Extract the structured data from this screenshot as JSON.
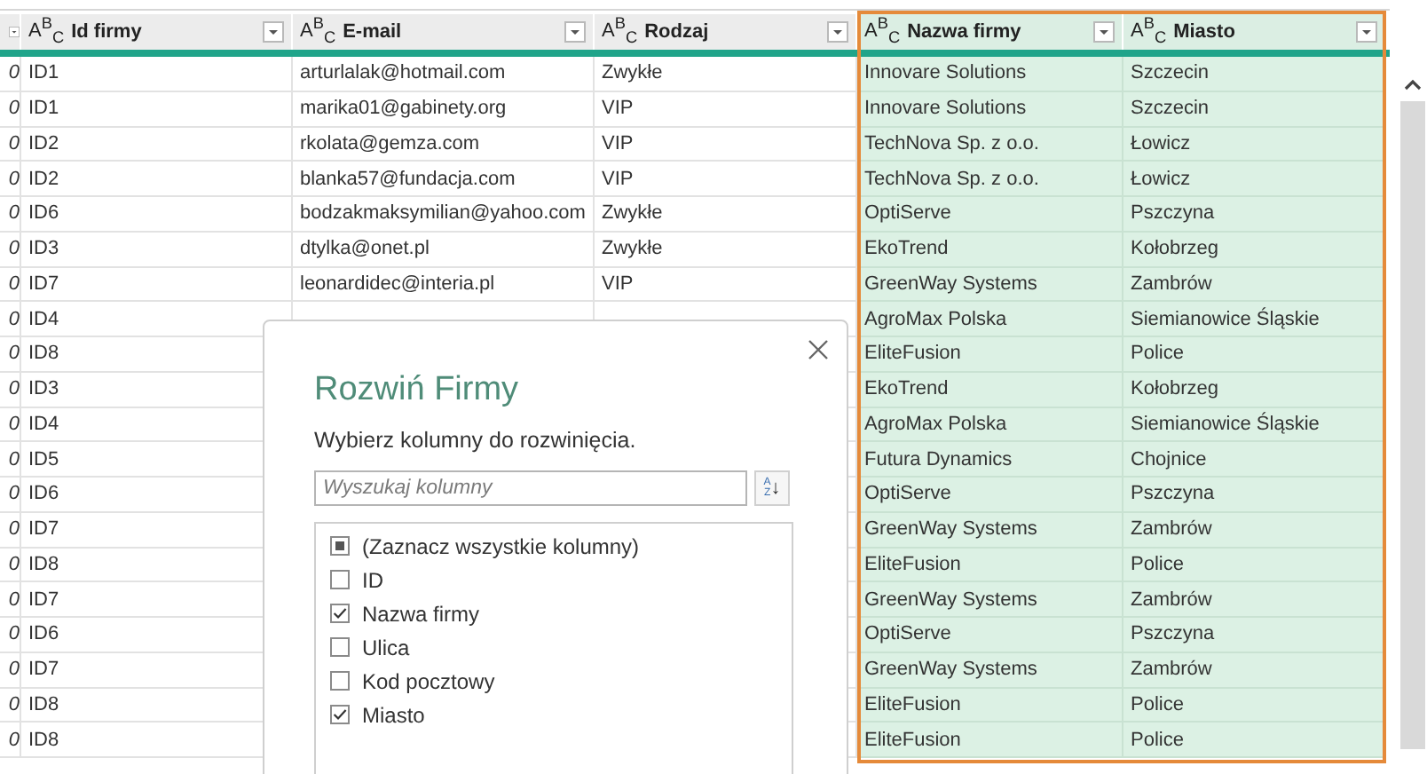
{
  "table": {
    "columns": [
      {
        "selected": false
      },
      {
        "name": "Id firmy",
        "type_icon": "A$^{B}$$_{C}$",
        "selected": false
      },
      {
        "name": "E-mail",
        "type_icon": "A$^{B}$$_{C}$",
        "selected": false
      },
      {
        "name": "Rodzaj",
        "type_icon": "A$^{B}$$_{C}$",
        "selected": false
      },
      {
        "name": "Nazwa firmy",
        "type_icon": "A$^{B}$$_{C}$",
        "selected": true
      },
      {
        "name": "Miasto",
        "type_icon": "A$^{B}$$_{C}$",
        "selected": true
      }
    ],
    "rows": [
      [
        "0",
        "ID1",
        "arturlalak@hotmail.com",
        "Zwykłe",
        "Innovare Solutions",
        "Szczecin"
      ],
      [
        "0",
        "ID1",
        "marika01@gabinety.org",
        "VIP",
        "Innovare Solutions",
        "Szczecin"
      ],
      [
        "0",
        "ID2",
        "rkolata@gemza.com",
        "VIP",
        "TechNova Sp. z o.o.",
        "Łowicz"
      ],
      [
        "0",
        "ID2",
        "blanka57@fundacja.com",
        "VIP",
        "TechNova Sp. z o.o.",
        "Łowicz"
      ],
      [
        "0",
        "ID6",
        "bodzakmaksymilian@yahoo.com",
        "Zwykłe",
        "OptiServe",
        "Pszczyna"
      ],
      [
        "0",
        "ID3",
        "dtylka@onet.pl",
        "Zwykłe",
        "EkoTrend",
        "Kołobrzeg"
      ],
      [
        "0",
        "ID7",
        "leonardidec@interia.pl",
        "VIP",
        "GreenWay Systems",
        "Zambrów"
      ],
      [
        "0",
        "ID4",
        null,
        null,
        "AgroMax Polska",
        "Siemianowice Śląskie"
      ],
      [
        "0",
        "ID8",
        null,
        null,
        "EliteFusion",
        "Police"
      ],
      [
        "0",
        "ID3",
        null,
        null,
        "EkoTrend",
        "Kołobrzeg"
      ],
      [
        "0",
        "ID4",
        null,
        null,
        "AgroMax Polska",
        "Siemianowice Śląskie"
      ],
      [
        "0",
        "ID5",
        null,
        null,
        "Futura Dynamics",
        "Chojnice"
      ],
      [
        "0",
        "ID6",
        null,
        null,
        "OptiServe",
        "Pszczyna"
      ],
      [
        "0",
        "ID7",
        null,
        null,
        "GreenWay Systems",
        "Zambrów"
      ],
      [
        "0",
        "ID8",
        null,
        null,
        "EliteFusion",
        "Police"
      ],
      [
        "0",
        "ID7",
        null,
        null,
        "GreenWay Systems",
        "Zambrów"
      ],
      [
        "0",
        "ID6",
        null,
        null,
        "OptiServe",
        "Pszczyna"
      ],
      [
        "0",
        "ID7",
        null,
        null,
        "GreenWay Systems",
        "Zambrów"
      ],
      [
        "0",
        "ID8",
        null,
        null,
        "EliteFusion",
        "Police"
      ],
      [
        "0",
        "ID8",
        null,
        null,
        "EliteFusion",
        "Police"
      ]
    ]
  },
  "dialog": {
    "title": "Rozwiń Firmy",
    "subtitle": "Wybierz kolumny do rozwinięcia.",
    "search": {
      "placeholder": "Wyszukaj kolumny"
    },
    "sort_button": {
      "top": "A",
      "bottom": "Z",
      "arrow": "↓"
    },
    "items": [
      {
        "label": "(Zaznacz wszystkie kolumny)",
        "checked": false,
        "indeterminate": true
      },
      {
        "label": "ID",
        "checked": false,
        "indeterminate": false
      },
      {
        "label": "Nazwa firmy",
        "checked": true,
        "indeterminate": false
      },
      {
        "label": "Ulica",
        "checked": false,
        "indeterminate": false
      },
      {
        "label": "Kod pocztowy",
        "checked": false,
        "indeterminate": false
      },
      {
        "label": "Miasto",
        "checked": true,
        "indeterminate": false
      }
    ]
  }
}
